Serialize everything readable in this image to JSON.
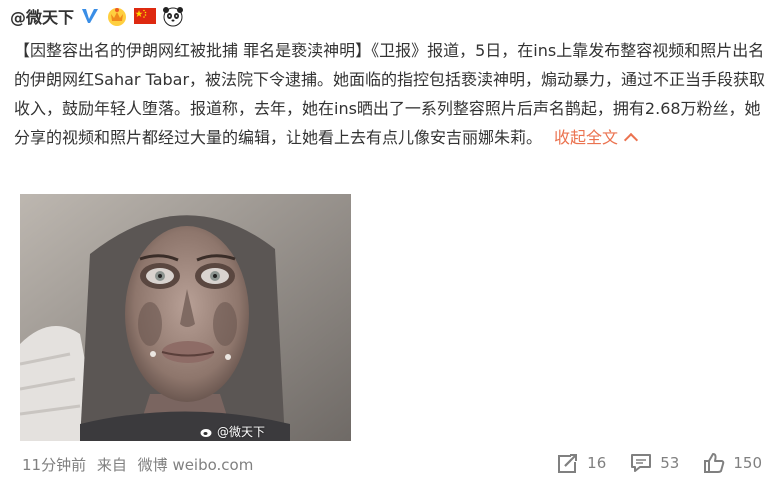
{
  "post": {
    "author": "@微天下",
    "headline": "【因整容出名的伊朗网红被批捕 罪名是亵渎神明】",
    "body": "《卫报》报道，5日，在ins上靠发布整容视频和照片出名的伊朗网红Sahar Tabar，被法院下令逮捕。她面临的指控包括亵渎神明，煽动暴力，通过不正当手段获取收入，鼓励年轻人堕落。报道称，去年，她在ins晒出了一系列整容照片后声名鹊起，拥有2.68万粉丝，她分享的视频和照片都经过大量的编辑，让她看上去有点儿像安吉丽娜朱莉。",
    "collapse_label": "收起全文",
    "image_watermark": "@微天下",
    "time": "11分钟前",
    "source_prefix": "来自",
    "source": "微博 weibo.com"
  },
  "actions": {
    "repost_count": "16",
    "comment_count": "53",
    "like_count": "150"
  },
  "colors": {
    "link": "#eb7350",
    "meta": "#808080",
    "verified": "#3a8ee6"
  },
  "icons": [
    "verified-icon",
    "vip-crown-icon",
    "china-flag-icon",
    "panda-icon",
    "repost-icon",
    "comment-icon",
    "like-icon",
    "chevron-up-icon"
  ]
}
